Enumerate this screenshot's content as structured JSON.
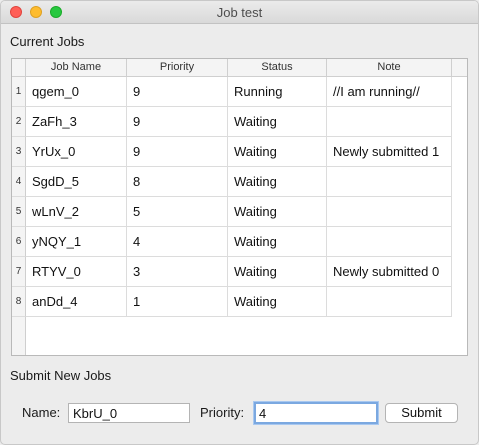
{
  "window": {
    "title": "Job test"
  },
  "current_jobs": {
    "label": "Current Jobs",
    "columns": [
      "Job Name",
      "Priority",
      "Status",
      "Note"
    ],
    "rows": [
      {
        "num": "1",
        "job_name": "qgem_0",
        "priority": "9",
        "status": "Running",
        "note": "//I am running//"
      },
      {
        "num": "2",
        "job_name": "ZaFh_3",
        "priority": "9",
        "status": "Waiting",
        "note": ""
      },
      {
        "num": "3",
        "job_name": "YrUx_0",
        "priority": "9",
        "status": "Waiting",
        "note": "Newly submitted 1"
      },
      {
        "num": "4",
        "job_name": "SgdD_5",
        "priority": "8",
        "status": "Waiting",
        "note": ""
      },
      {
        "num": "5",
        "job_name": "wLnV_2",
        "priority": "5",
        "status": "Waiting",
        "note": ""
      },
      {
        "num": "6",
        "job_name": "yNQY_1",
        "priority": "4",
        "status": "Waiting",
        "note": ""
      },
      {
        "num": "7",
        "job_name": "RTYV_0",
        "priority": "3",
        "status": "Waiting",
        "note": "Newly submitted 0"
      },
      {
        "num": "8",
        "job_name": "anDd_4",
        "priority": "1",
        "status": "Waiting",
        "note": ""
      }
    ]
  },
  "submit": {
    "label": "Submit New Jobs",
    "name_label": "Name:",
    "name_value": "KbrU_0",
    "priority_label": "Priority:",
    "priority_value": "4",
    "button_label": "Submit"
  }
}
